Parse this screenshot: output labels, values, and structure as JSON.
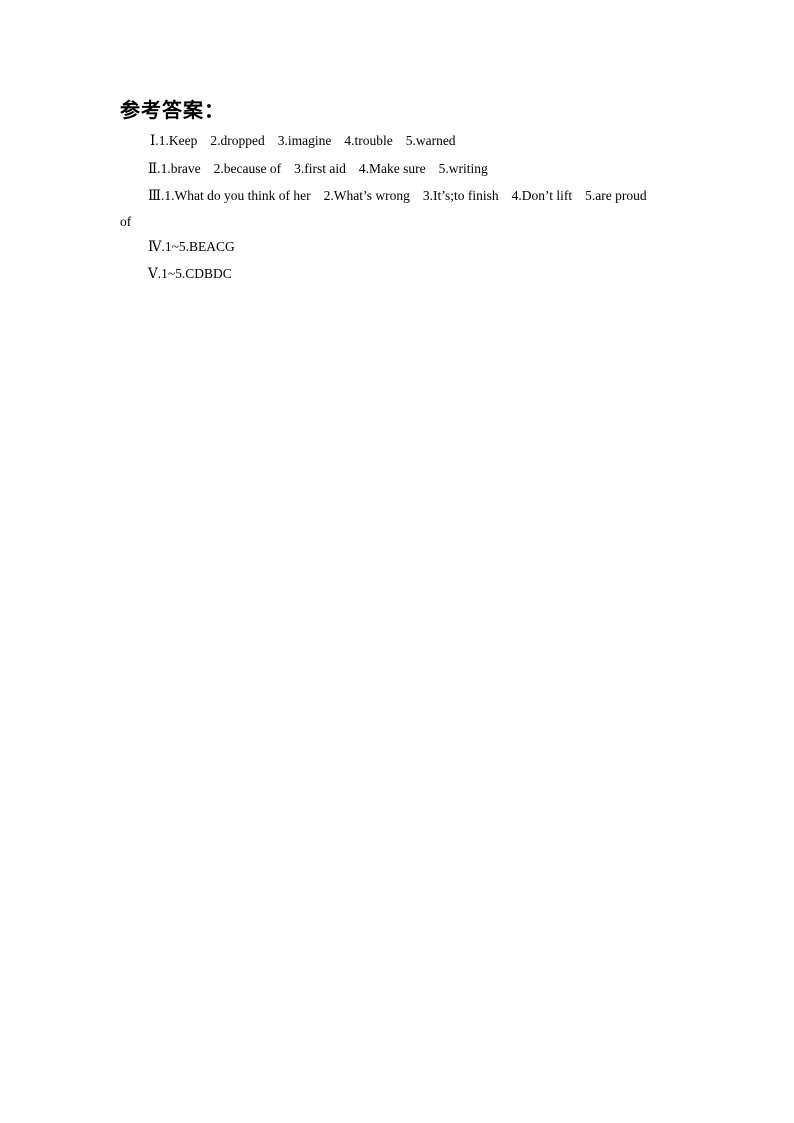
{
  "heading": "参考答案：",
  "sections": [
    {
      "numeral": "Ⅰ.",
      "items": [
        "1.Keep",
        "2.dropped",
        "3.imagine",
        "4.trouble",
        "5.warned"
      ]
    },
    {
      "numeral": "Ⅱ.",
      "items": [
        "1.brave",
        "2.because of",
        "3.first aid",
        "4.Make sure",
        "5.writing"
      ]
    },
    {
      "numeral": "Ⅲ.",
      "items": [
        "1.What do you think of her",
        "2.What’s wrong",
        "3.It’s;to finish",
        "4.Don’t lift",
        "5.are proud"
      ],
      "continuation": "of"
    },
    {
      "numeral": "Ⅳ.",
      "items": [
        "1~5.BEACG"
      ]
    },
    {
      "numeral": "Ⅴ.",
      "items": [
        "1~5.CDBDC"
      ]
    }
  ]
}
